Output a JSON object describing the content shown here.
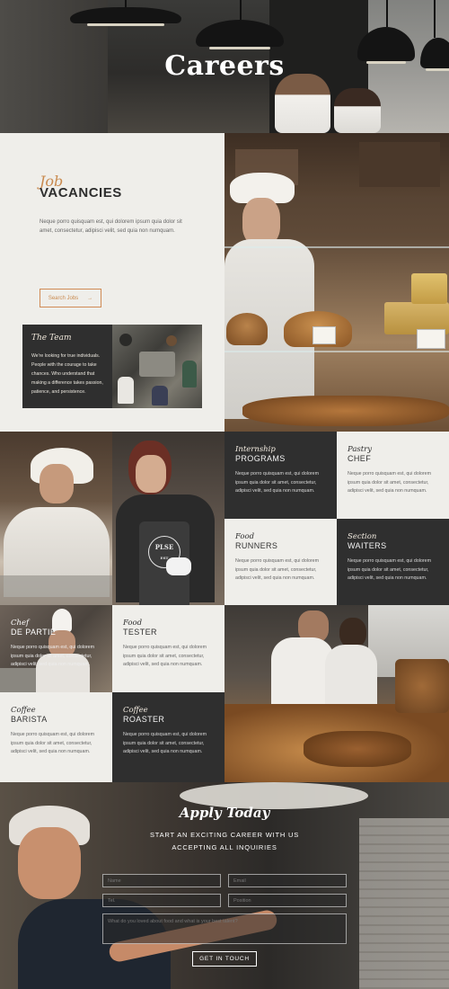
{
  "hero": {
    "title": "Careers"
  },
  "vacancies": {
    "script": "Job",
    "title": "VACANCIES",
    "text": "Neque porro quisquam est, qui dolorem ipsum quia dolor sit amet, consectetur, adipisci velit, sed quia non numquam.",
    "search_label": "Search Jobs",
    "search_arrow": "→"
  },
  "team": {
    "title": "The Team",
    "text": "We're looking for true individuals. People with the courage to take chances. Who understand that making a difference takes passion, patience, and persistence."
  },
  "tiles": [
    {
      "script": "Internship",
      "title": "PROGRAMS",
      "text": "Neque porro quisquam est, qui dolorem ipsum quia dolor sit amet, consectetur, adipisci velit, sed quia non numquam."
    },
    {
      "script": "Pastry",
      "title": "CHEF",
      "text": "Neque porro quisquam est, qui dolorem ipsum quia dolor sit amet, consectetur, adipisci velit, sed quia non numquam."
    },
    {
      "script": "Food",
      "title": "RUNNERS",
      "text": "Neque porro quisquam est, qui dolorem ipsum quia dolor sit amet, consectetur, adipisci velit, sed quia non numquam."
    },
    {
      "script": "Section",
      "title": "WAITERS",
      "text": "Neque porro quisquam est, qui dolorem ipsum quia dolor sit amet, consectetur, adipisci velit, sed quia non numquam."
    },
    {
      "script": "Chef",
      "title": "DE PARTIE",
      "text": "Neque porro quisquam est, qui dolorem ipsum quia dolor sit amet, consectetur, adipisci velit, sed quia non numquam."
    },
    {
      "script": "Food",
      "title": "TESTER",
      "text": "Neque porro quisquam est, qui dolorem ipsum quia dolor sit amet, consectetur, adipisci velit, sed quia non numquam."
    },
    {
      "script": "Coffee",
      "title": "BARISTA",
      "text": "Neque porro quisquam est, qui dolorem ipsum quia dolor sit amet, consectetur, adipisci velit, sed quia non numquam."
    },
    {
      "script": "Coffee",
      "title": "ROASTER",
      "text": "Neque porro quisquam est, qui dolorem ipsum quia dolor sit amet, consectetur, adipisci velit, sed quia non numquam."
    }
  ],
  "apron_logo": {
    "line1": "PLSE",
    "line2": "EST"
  },
  "apply": {
    "title": "Apply Today",
    "subtitle_line1": "START AN EXCITING CAREER WITH US",
    "subtitle_line2": "ACCEPTING ALL INQUIRIES",
    "name_placeholder": "Name",
    "email_placeholder": "Email",
    "tel_placeholder": "Tel.",
    "position_placeholder": "Position",
    "message_placeholder": "What do you loved about food and what is your best talent?",
    "button_label": "GET IN TOUCH"
  },
  "colors": {
    "accent": "#c98a4f",
    "dark_tile": "#2f2f2f",
    "light_tile": "#efeeea"
  }
}
